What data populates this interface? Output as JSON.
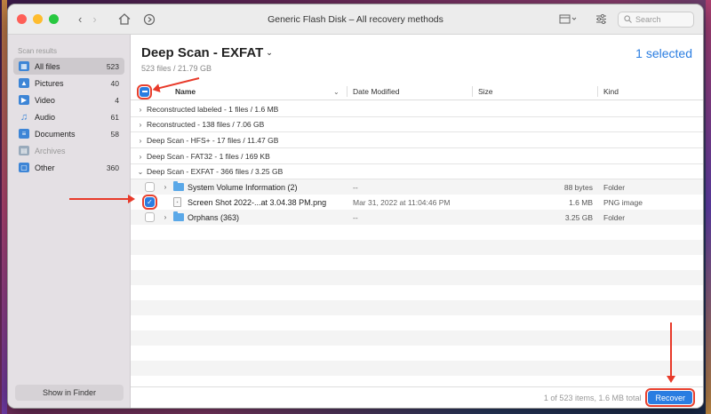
{
  "window": {
    "title": "Generic Flash Disk – All recovery methods"
  },
  "toolbar": {
    "search_placeholder": "Search"
  },
  "sidebar": {
    "heading": "Scan results",
    "items": [
      {
        "label": "All files",
        "count": "523",
        "icon": "all-files-icon"
      },
      {
        "label": "Pictures",
        "count": "40",
        "icon": "pictures-icon"
      },
      {
        "label": "Video",
        "count": "4",
        "icon": "video-icon"
      },
      {
        "label": "Audio",
        "count": "61",
        "icon": "audio-icon"
      },
      {
        "label": "Documents",
        "count": "58",
        "icon": "documents-icon"
      },
      {
        "label": "Archives",
        "count": "",
        "icon": "archives-icon"
      },
      {
        "label": "Other",
        "count": "360",
        "icon": "other-icon"
      }
    ],
    "finder_button": "Show in Finder"
  },
  "main": {
    "title": "Deep Scan - EXFAT",
    "subtitle": "523 files / 21.79 GB",
    "selected": "1 selected",
    "columns": {
      "name": "Name",
      "date": "Date Modified",
      "size": "Size",
      "kind": "Kind"
    },
    "groups": [
      "Reconstructed labeled - 1 files / 1.6 MB",
      "Reconstructed - 138 files / 7.06 GB",
      "Deep Scan - HFS+ - 17 files / 11.47 GB",
      "Deep Scan - FAT32 - 1 files / 169 KB",
      "Deep Scan - EXFAT - 366 files / 3.25 GB"
    ],
    "files": [
      {
        "name": "System Volume Information (2)",
        "date": "--",
        "size": "88 bytes",
        "kind": "Folder"
      },
      {
        "name": "Screen Shot 2022-...at 3.04.38 PM.png",
        "date": "Mar 31, 2022 at 11:04:46 PM",
        "size": "1.6 MB",
        "kind": "PNG image"
      },
      {
        "name": "Orphans (363)",
        "date": "--",
        "size": "3.25 GB",
        "kind": "Folder"
      }
    ]
  },
  "footer": {
    "status": "1 of 523 items, 1.6 MB total",
    "recover": "Recover"
  },
  "colors": {
    "accent": "#2a7de1",
    "annotation": "#e83a2a"
  }
}
